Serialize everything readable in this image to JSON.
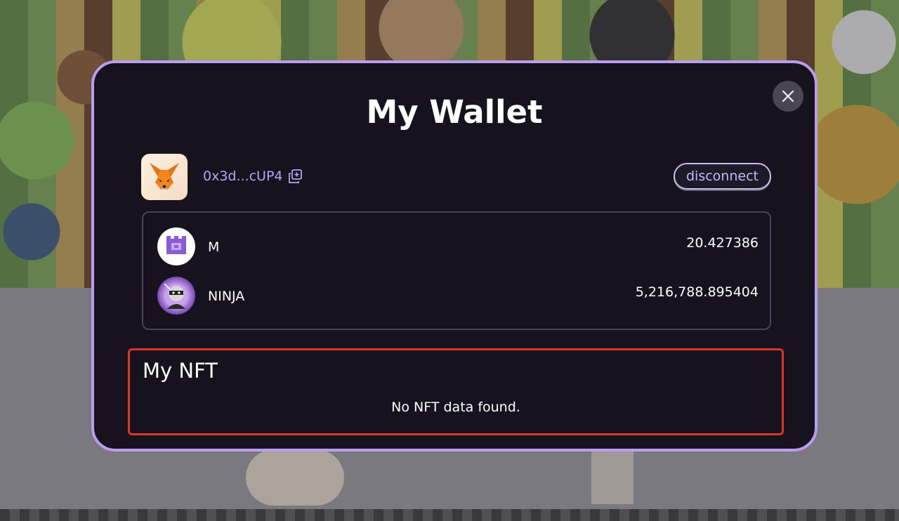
{
  "modal": {
    "title": "My Wallet",
    "close_icon": "close-icon",
    "accent_border": "#b89df0",
    "background": "#16131f"
  },
  "wallet": {
    "provider_icon": "metamask-fox-icon",
    "address": "0x3d...cUP4",
    "copy_icon": "copy-icon",
    "disconnect_label": "disconnect"
  },
  "tokens": [
    {
      "icon": "m-token-icon",
      "name": "M",
      "value": "20.427386"
    },
    {
      "icon": "ninja-token-icon",
      "name": "NINJA",
      "value": "5,216,788.895404"
    }
  ],
  "nft": {
    "title": "My NFT",
    "empty_message": "No NFT data found.",
    "highlight_color": "#e03226"
  }
}
